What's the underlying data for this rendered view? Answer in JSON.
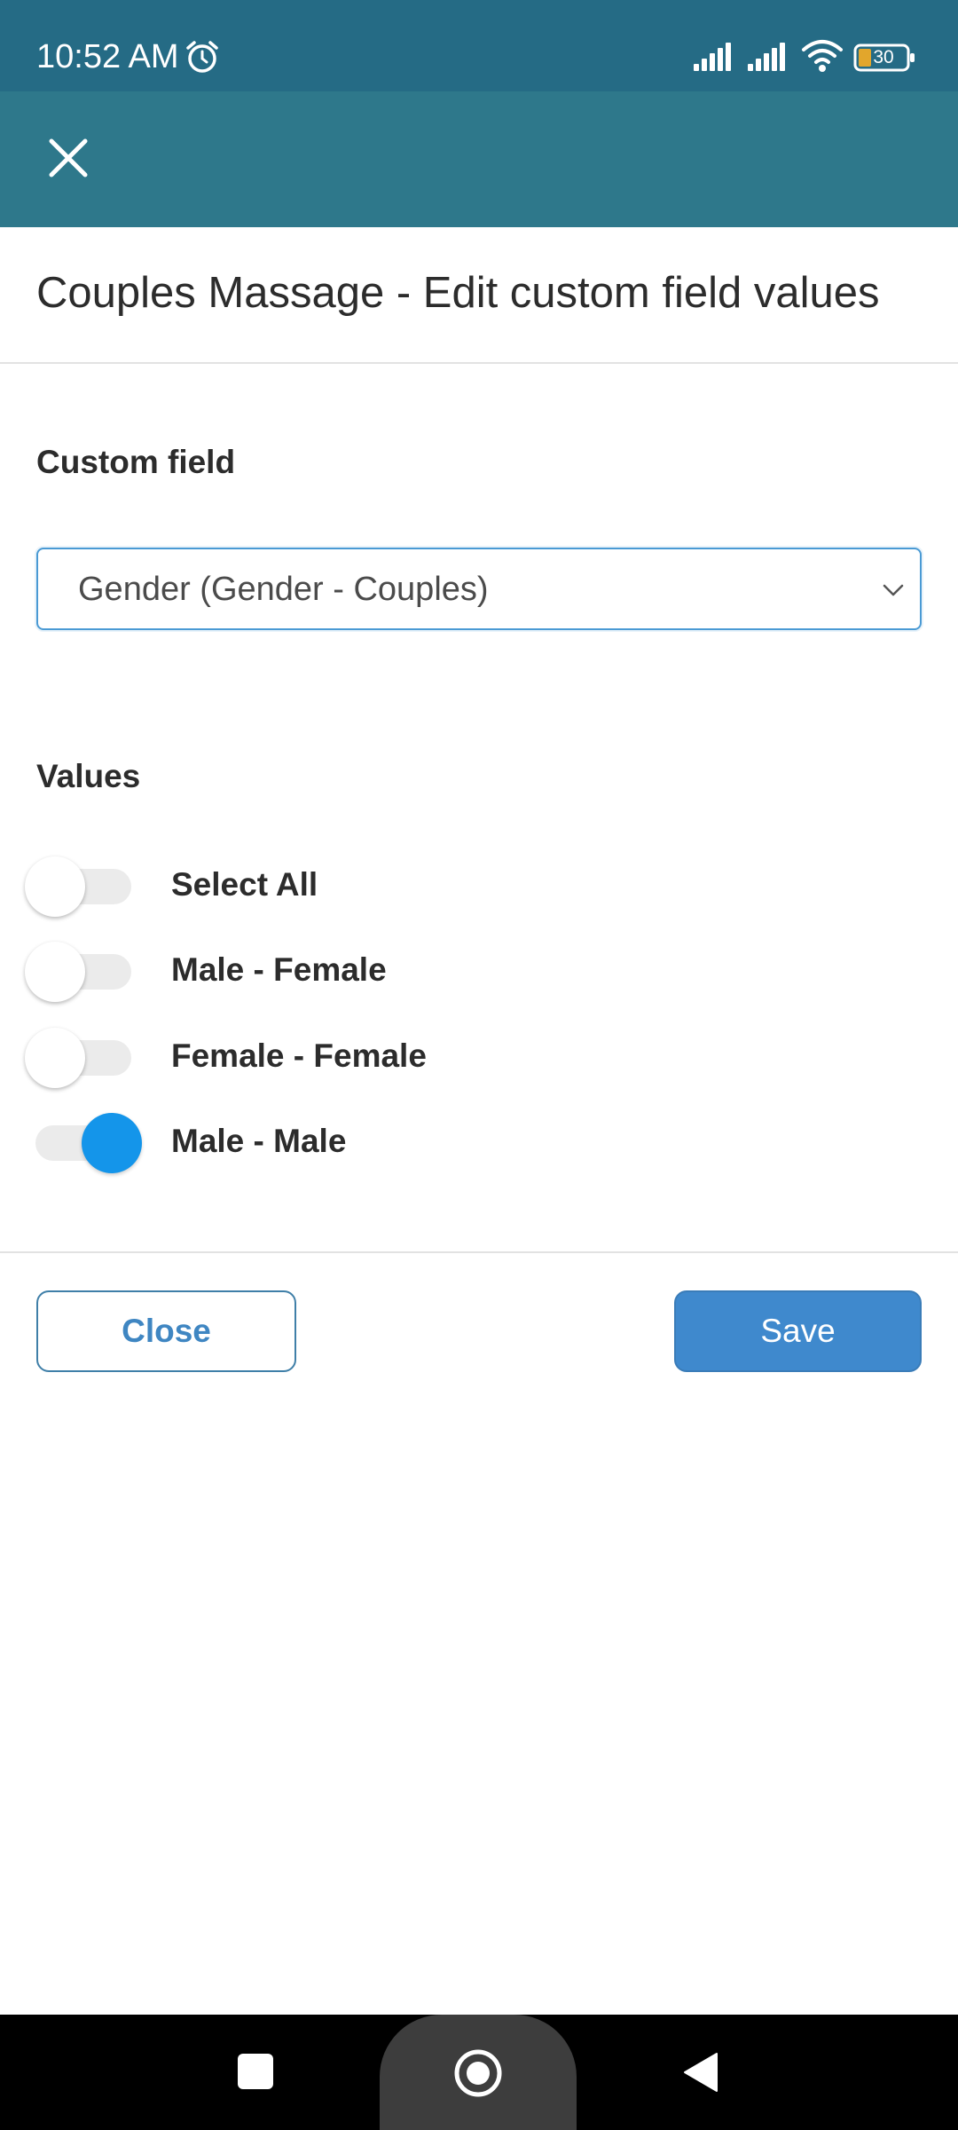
{
  "status_bar": {
    "time": "10:52 AM",
    "battery_level": "30",
    "icons": [
      "alarm-icon",
      "signal-icon",
      "signal-icon",
      "wifi-icon",
      "battery-icon"
    ]
  },
  "app_bar": {
    "close_icon": "close-icon"
  },
  "dialog": {
    "title": "Couples Massage - Edit custom field values",
    "custom_field": {
      "label": "Custom field",
      "selected": "Gender (Gender - Couples)"
    },
    "values": {
      "label": "Values",
      "options": [
        {
          "label": "Select All",
          "checked": false
        },
        {
          "label": "Male - Female",
          "checked": false
        },
        {
          "label": "Female - Female",
          "checked": false
        },
        {
          "label": "Male - Male",
          "checked": true
        }
      ]
    },
    "buttons": {
      "close": "Close",
      "save": "Save"
    }
  },
  "colors": {
    "status_bar": "#256b85",
    "app_bar": "#2e788b",
    "accent": "#1495ea",
    "primary_button": "#3f89cd",
    "battery_fill": "#e2a62c"
  }
}
